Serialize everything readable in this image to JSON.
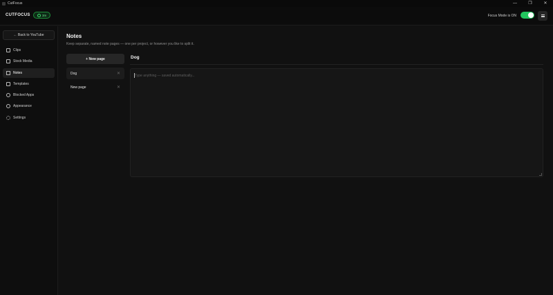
{
  "window": {
    "title": "CutFocus",
    "controls": {
      "minimize": "—",
      "restore": "❐",
      "close": "✕"
    }
  },
  "header": {
    "brand": "CUTFOCUS",
    "timer_badge": "3m",
    "focus_mode_label": "Focus Mode is ON",
    "focus_mode_on": true,
    "accent_color": "#22c55e"
  },
  "sidebar": {
    "back_label": "← Back to YouTube",
    "items": [
      {
        "label": "Clips",
        "icon": "clips-icon",
        "active": false
      },
      {
        "label": "Stock Media",
        "icon": "stock-media-icon",
        "active": false
      },
      {
        "label": "Notes",
        "icon": "notes-icon",
        "active": true
      },
      {
        "label": "Templates",
        "icon": "templates-icon",
        "active": false
      },
      {
        "label": "Blocked Apps",
        "icon": "blocked-apps-icon",
        "active": false
      },
      {
        "label": "Appearance",
        "icon": "appearance-icon",
        "active": false
      },
      {
        "label": "Settings",
        "icon": "settings-icon",
        "active": false
      }
    ]
  },
  "main": {
    "title": "Notes",
    "subtitle": "Keep separate, named note pages — one per project, or however you like to split it.",
    "new_page_label": "+ New page",
    "pages": [
      {
        "label": "Dog",
        "active": true
      },
      {
        "label": "New page",
        "active": false
      }
    ],
    "editor": {
      "title": "Dog",
      "value": "",
      "placeholder": "Type anything — saved automatically..."
    }
  }
}
